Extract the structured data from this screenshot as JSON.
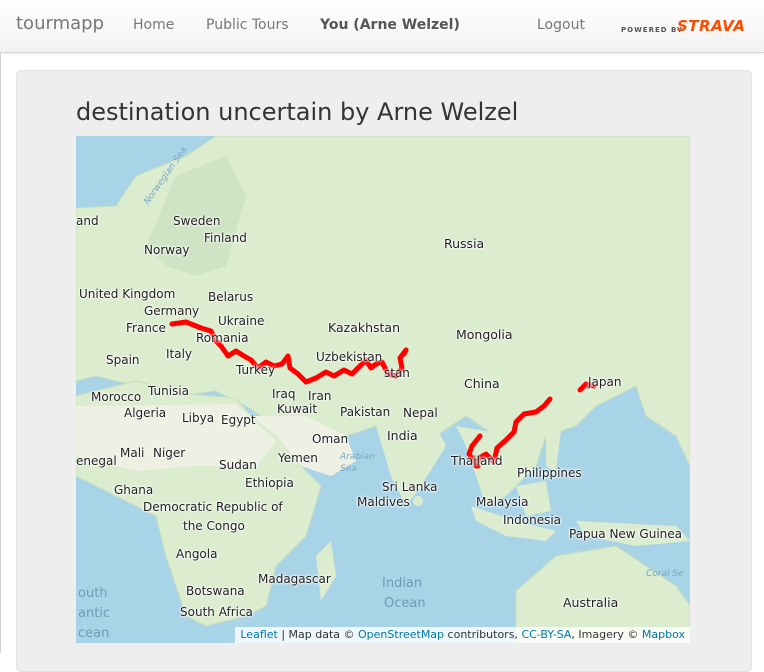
{
  "nav": {
    "brand": "tourmapp",
    "home": "Home",
    "public_tours": "Public Tours",
    "you": "You (Arne Welzel)",
    "logout": "Logout",
    "strava_powered": "POWERED BY",
    "strava_word": "STRAVA"
  },
  "page": {
    "title": "destination uncertain by Arne Welzel"
  },
  "map": {
    "labels": {
      "norwegian_sea": "Norwegian Sea",
      "sweden": "Sweden",
      "finland": "Finland",
      "norway": "Norway",
      "land": "and",
      "russia": "Russia",
      "uk": "United Kingdom",
      "belarus": "Belarus",
      "germany": "Germany",
      "ukraine": "Ukraine",
      "france": "France",
      "kazakhstan": "Kazakhstan",
      "mongolia": "Mongolia",
      "romania": "Romania",
      "spain": "Spain",
      "italy": "Italy",
      "uzbekistan": "Uzbekistan",
      "turkey": "Turkey",
      "tajikistan": "stan",
      "japan": "Japan",
      "tunisia": "Tunisia",
      "china": "China",
      "morocco": "Morocco",
      "iraq": "Iraq",
      "iran": "Iran",
      "algeria": "Algeria",
      "libya": "Libya",
      "egypt": "Egypt",
      "kuwait": "Kuwait",
      "pakistan": "Pakistan",
      "nepal": "Nepal",
      "oman": "Oman",
      "india": "India",
      "senegal": "enegal",
      "mali": "Mali",
      "niger": "Niger",
      "thailand": "Thailand",
      "sudan": "Sudan",
      "yemen": "Yemen",
      "arabian_sea": "Arabian Sea",
      "philippines": "Philippines",
      "ethiopia": "Ethiopia",
      "ghana": "Ghana",
      "sri_lanka": "Sri Lanka",
      "maldives": "Maldives",
      "malaysia": "Malaysia",
      "drc1": "Democratic Republic of",
      "drc2": "the Congo",
      "indonesia": "Indonesia",
      "png": "Papua New Guinea",
      "angola": "Angola",
      "coral_sea": "Coral Se",
      "madagascar": "Madagascar",
      "south_atlantic1": "outh",
      "south_atlantic2": "antic",
      "south_atlantic3": "cean",
      "indian1": "Indian",
      "indian2": "Ocean",
      "botswana": "Botswana",
      "australia": "Australia",
      "south_africa": "South Africa"
    },
    "attribution": {
      "leaflet": "Leaflet",
      "sep": " | Map data © ",
      "osm": "OpenStreetMap",
      "contrib": " contributors, ",
      "ccbysa": "CC-BY-SA",
      "imagery": ", Imagery © ",
      "mapbox": "Mapbox"
    },
    "route_color": "#ff0000",
    "land_color": "#d9ead3",
    "water_color": "#a9d4e8"
  }
}
